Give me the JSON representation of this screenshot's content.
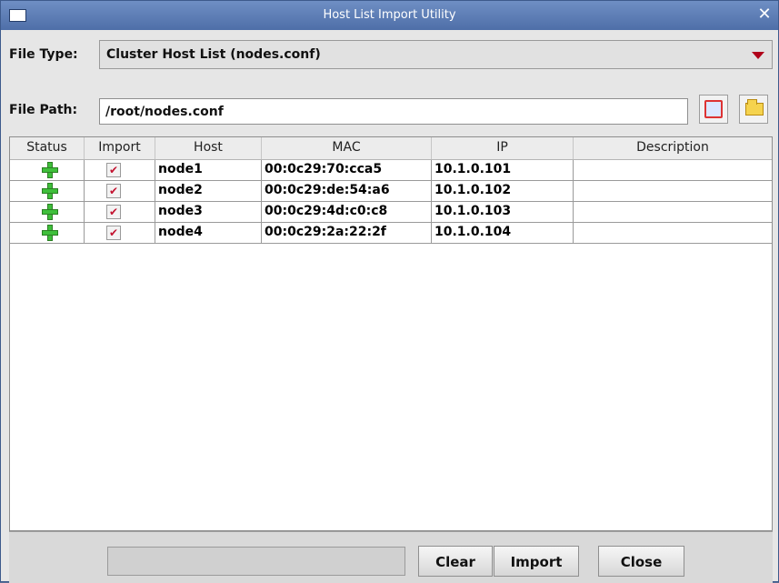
{
  "window": {
    "title": "Host List Import Utility"
  },
  "file_type": {
    "label": "File Type:",
    "value": "Cluster Host List (nodes.conf)"
  },
  "file_path": {
    "label": "File Path:",
    "value": "/root/nodes.conf"
  },
  "table": {
    "columns": [
      "Status",
      "Import",
      "Host",
      "MAC",
      "IP",
      "Description"
    ],
    "rows": [
      {
        "status": "plus-icon",
        "import": true,
        "host": "node1",
        "mac": "00:0c29:70:cca5",
        "ip": "10.1.0.101",
        "description": ""
      },
      {
        "status": "plus-icon",
        "import": true,
        "host": "node2",
        "mac": "00:0c29:de:54:a6",
        "ip": "10.1.0.102",
        "description": ""
      },
      {
        "status": "plus-icon",
        "import": true,
        "host": "node3",
        "mac": "00:0c29:4d:c0:c8",
        "ip": "10.1.0.103",
        "description": ""
      },
      {
        "status": "plus-icon",
        "import": true,
        "host": "node4",
        "mac": "00:0c29:2a:22:2f",
        "ip": "10.1.0.104",
        "description": ""
      }
    ]
  },
  "buttons": {
    "clear": "Clear",
    "import": "Import",
    "close": "Close"
  },
  "colors": {
    "titlebar": "#5b7bb3",
    "accent_red": "#b0001a",
    "plus_green": "#3fbf3b"
  }
}
